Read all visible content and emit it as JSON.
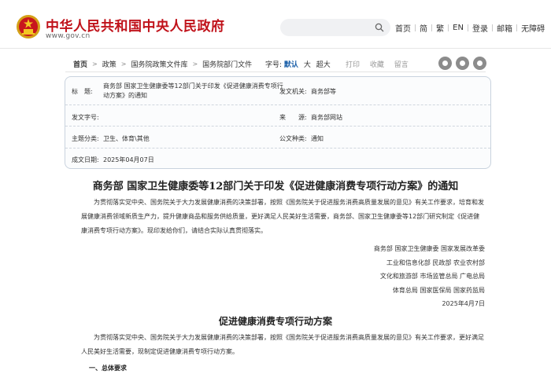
{
  "header": {
    "site_title": "中华人民共和国中央人民政府",
    "site_url": "www.gov.cn",
    "search_placeholder": "",
    "nav": [
      "首页",
      "简",
      "繁",
      "EN",
      "登录",
      "邮箱",
      "无障碍"
    ]
  },
  "breadcrumb": {
    "items": [
      "首页",
      "政策",
      "国务院政策文件库",
      "国务院部门文件"
    ]
  },
  "toolbar": {
    "font_label": "字号:",
    "font_default": "默认",
    "font_large": "大",
    "font_xlarge": "超大",
    "print": "打印",
    "favorite": "收藏",
    "message": "留言"
  },
  "info": {
    "title_label": "标　题:",
    "title_value": "商务部 国家卫生健康委等12部门关于印发《促进健康消费专项行动方案》的通知",
    "issuer_label": "发文机关:",
    "issuer_value": "商务部等",
    "doc_no_label": "发文字号:",
    "doc_no_value": "",
    "source_label": "来　　源:",
    "source_value": "商务部网站",
    "topic_label": "主题分类:",
    "topic_value": "卫生、体育\\其他",
    "genre_label": "公文种类:",
    "genre_value": "通知",
    "date_label": "成文日期:",
    "date_value": "2025年04月07日"
  },
  "article": {
    "title": "商务部 国家卫生健康委等12部门关于印发《促进健康消费专项行动方案》的通知",
    "intro": "为贯彻落实党中央、国务院关于大力发展健康消费的决策部署，按照《国务院关于促进服务消费高质量发展的意见》有关工作要求，培育和发展健康消费领域新质生产力，提升健康商品和服务供给质量，更好满足人民美好生活需要，商务部、国家卫生健康委等12部门研究制定《促进健康消费专项行动方案》。现印发给你们，请结合实际认真贯彻落实。",
    "signers": [
      "商务部 国家卫生健康委 国家发展改革委",
      "工业和信息化部 民政部 农业农村部",
      "文化和旅游部 市场监管总局 广电总局",
      "体育总局 国家医保局 国家药监局",
      "2025年4月7日"
    ],
    "plan_title": "促进健康消费专项行动方案",
    "plan_intro": "为贯彻落实党中央、国务院关于大力发展健康消费的决策部署，按照《国务院关于促进服务消费高质量发展的意见》有关工作要求，更好满足人民美好生活需要，现制定促进健康消费专项行动方案。",
    "section1": "一、总体要求"
  }
}
